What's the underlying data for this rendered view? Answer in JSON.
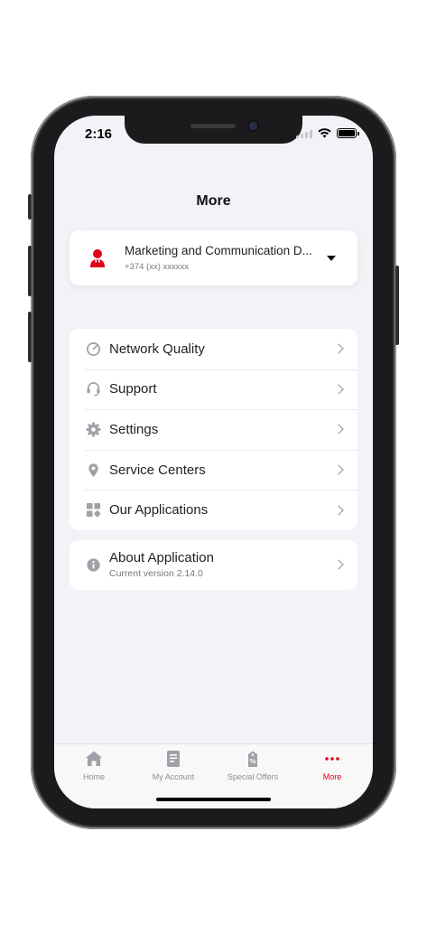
{
  "status_bar": {
    "time": "2:16"
  },
  "header": {
    "title": "More"
  },
  "account": {
    "name": "Marketing and Communication D...",
    "phone": "+374 (xx) xxxxxx",
    "avatar_icon": "person-icon",
    "dropdown_icon": "caret-down-icon"
  },
  "menu": {
    "items": [
      {
        "label": "Network Quality",
        "icon": "gauge-icon"
      },
      {
        "label": "Support",
        "icon": "headset-icon"
      },
      {
        "label": "Settings",
        "icon": "gear-icon"
      },
      {
        "label": "Service Centers",
        "icon": "location-pin-icon"
      },
      {
        "label": "Our Applications",
        "icon": "grid-icon"
      }
    ]
  },
  "about": {
    "label": "About Application",
    "version": "Current version 2.14.0",
    "icon": "info-icon"
  },
  "tabs": [
    {
      "label": "Home",
      "icon": "home-icon",
      "active": false
    },
    {
      "label": "My Account",
      "icon": "account-receipt-icon",
      "active": false
    },
    {
      "label": "Special Offers",
      "icon": "offer-tag-icon",
      "active": false
    },
    {
      "label": "More",
      "icon": "more-dots-icon",
      "active": true
    }
  ],
  "colors": {
    "accent": "#e2001a",
    "background": "#f2f2f7",
    "icon_gray": "#a0a0a8"
  }
}
